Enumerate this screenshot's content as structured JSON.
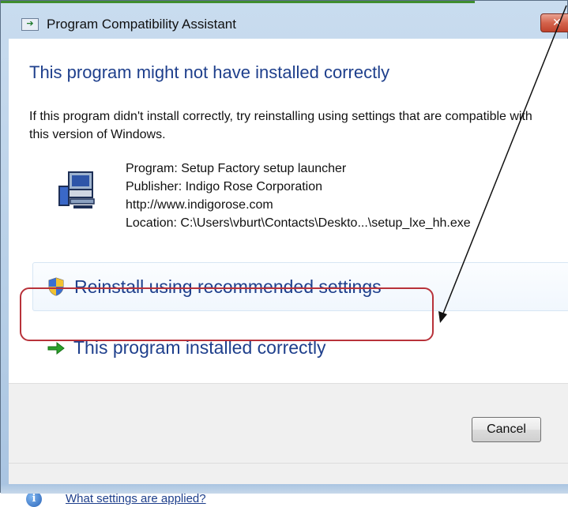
{
  "window": {
    "title": "Program Compatibility Assistant",
    "close_glyph": "✕",
    "app_icon": "compatibility-assistant-icon"
  },
  "main": {
    "heading": "This program might not have installed correctly",
    "description": "If this program didn't install correctly, try reinstalling using settings that are compatible with this version of Windows.",
    "program_icon": "installer-computer-icon",
    "program": "Program: Setup Factory setup launcher",
    "publisher": "Publisher: Indigo Rose Corporation",
    "url": "http://www.indigorose.com",
    "location": "Location: C:\\Users\\vburt\\Contacts\\Deskto...\\setup_lxe_hh.exe"
  },
  "options": [
    {
      "label": "Reinstall using recommended settings",
      "icon": "uac-shield-icon"
    },
    {
      "label": "This program installed correctly",
      "icon": "green-arrow-icon"
    }
  ],
  "footer": {
    "cancel_label": "Cancel",
    "help_link": "What settings are applied?",
    "help_icon": "info-icon"
  },
  "colors": {
    "heading_blue": "#1e3f8c",
    "annotation_red": "#b8323a",
    "arrow_green": "#2aa02a"
  }
}
